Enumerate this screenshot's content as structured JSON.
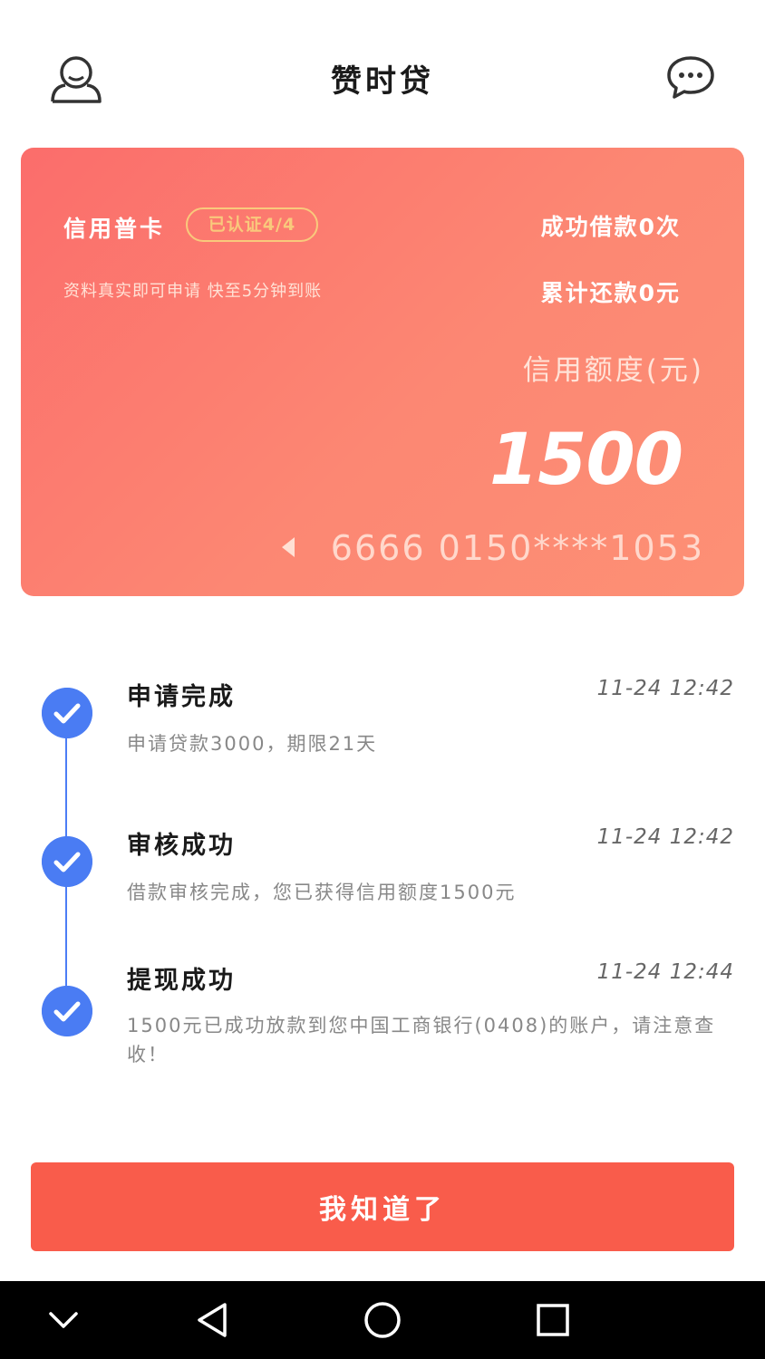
{
  "header": {
    "title": "赞时贷",
    "left_icon": "user-icon",
    "right_icon": "chat-icon"
  },
  "card": {
    "card_type": "信用普卡",
    "badge": "已认证4/4",
    "subtitle": "资料真实即可申请 快至5分钟到账",
    "success_loans": "成功借款0次",
    "total_repaid": "累计还款0元",
    "limit_label": "信用额度(元)",
    "amount": "1500",
    "card_number": "6666 0150****1053",
    "gradient_start": "#fb6d6b",
    "gradient_end": "#fd9075",
    "badge_color": "#f9c97c"
  },
  "timeline": {
    "steps": [
      {
        "title": "申请完成",
        "time": "11-24 12:42",
        "desc": "申请贷款3000，期限21天"
      },
      {
        "title": "审核成功",
        "time": "11-24 12:42",
        "desc": "借款审核完成，您已获得信用额度1500元"
      },
      {
        "title": "提现成功",
        "time": "11-24 12:44",
        "desc": "1500元已成功放款到您中国工商银行(0408)的账户，请注意查收！"
      }
    ],
    "accent_color": "#4a7cf3"
  },
  "button": {
    "label": "我知道了",
    "color": "#f95c4b"
  },
  "navbar": {
    "icons": [
      "chevron-down-icon",
      "back-icon",
      "home-icon",
      "recents-icon"
    ]
  }
}
